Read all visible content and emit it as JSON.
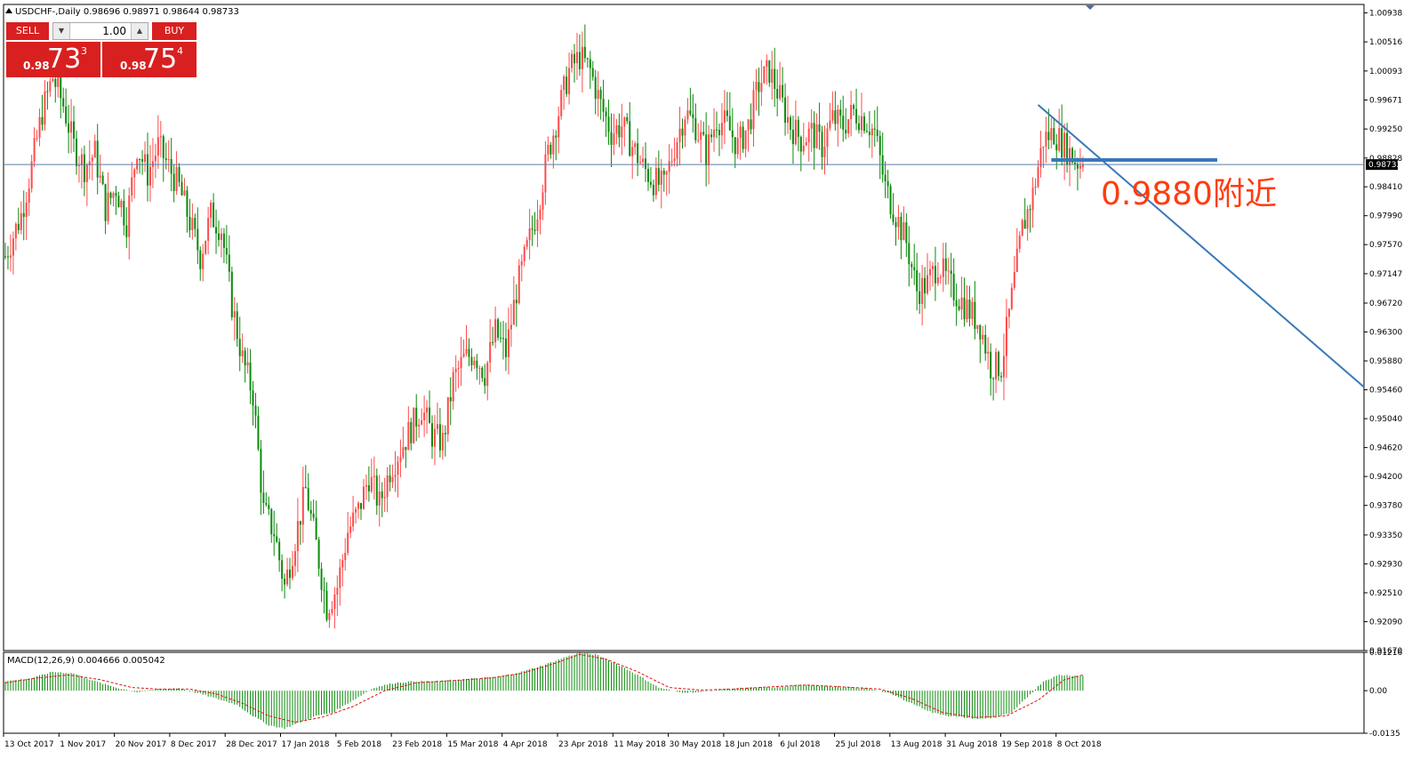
{
  "window": {
    "header": "USDCHF-,Daily  0.98696 0.98971 0.98644 0.98733"
  },
  "trade_panel": {
    "sell_label": "SELL",
    "buy_label": "BUY",
    "lot": "1.00",
    "lot_down_icon": "triangle-down-icon",
    "lot_up_icon": "triangle-up-icon",
    "sell_small": "0.98",
    "sell_big": "73",
    "sell_sup": "3",
    "buy_small": "0.98",
    "buy_big": "75",
    "buy_sup": "4",
    "color": "#d82020"
  },
  "annotation": {
    "text": "0.9880附近",
    "color": "#ff3c10",
    "trendline_color": "#3a78b8"
  },
  "colors": {
    "bull": "#ff4a4a",
    "bear": "#0b8a0b",
    "grid_line": "#5b7fa6",
    "macd_hist": "#0b8a0b",
    "macd_signal": "#e01010"
  },
  "chart_data": [
    {
      "type": "candlestick",
      "symbol": "USDCHF-",
      "timeframe": "Daily",
      "ohlc_header": {
        "open": 0.98696,
        "high": 0.98971,
        "low": 0.98644,
        "close": 0.98733
      },
      "current_price": "0.98733",
      "y_ticks": [
        "1.00938",
        "1.00516",
        "1.00093",
        "0.99671",
        "0.99250",
        "0.98828",
        "0.98410",
        "0.97990",
        "0.97570",
        "0.97147",
        "0.96720",
        "0.96300",
        "0.95880",
        "0.95460",
        "0.95040",
        "0.94620",
        "0.94200",
        "0.93780",
        "0.93350",
        "0.92930",
        "0.92510",
        "0.92090",
        "0.91670"
      ],
      "ylim": [
        0.9167,
        1.0106
      ],
      "x_labels": [
        "13 Oct 2017",
        "1 Nov 2017",
        "20 Nov 2017",
        "8 Dec 2017",
        "28 Dec 2017",
        "17 Jan 2018",
        "5 Feb 2018",
        "23 Feb 2018",
        "15 Mar 2018",
        "4 Apr 2018",
        "23 Apr 2018",
        "11 May 2018",
        "30 May 2018",
        "18 Jun 2018",
        "6 Jul 2018",
        "25 Jul 2018",
        "13 Aug 2018",
        "31 Aug 2018",
        "19 Sep 2018",
        "8 Oct 2018"
      ],
      "close_path": [
        [
          0,
          0.974
        ],
        [
          6,
          0.98
        ],
        [
          10,
          0.987
        ],
        [
          14,
          0.995
        ],
        [
          18,
          1.0
        ],
        [
          22,
          0.996
        ],
        [
          26,
          0.99
        ],
        [
          30,
          0.987
        ],
        [
          34,
          0.989
        ],
        [
          38,
          0.981
        ],
        [
          42,
          0.984
        ],
        [
          46,
          0.979
        ],
        [
          50,
          0.99
        ],
        [
          54,
          0.986
        ],
        [
          58,
          0.99
        ],
        [
          62,
          0.987
        ],
        [
          66,
          0.984
        ],
        [
          70,
          0.979
        ],
        [
          74,
          0.974
        ],
        [
          78,
          0.98
        ],
        [
          82,
          0.978
        ],
        [
          86,
          0.967
        ],
        [
          90,
          0.959
        ],
        [
          94,
          0.954
        ],
        [
          98,
          0.937
        ],
        [
          102,
          0.934
        ],
        [
          106,
          0.926
        ],
        [
          110,
          0.933
        ],
        [
          114,
          0.94
        ],
        [
          118,
          0.932
        ],
        [
          122,
          0.923
        ],
        [
          126,
          0.926
        ],
        [
          130,
          0.934
        ],
        [
          134,
          0.937
        ],
        [
          138,
          0.942
        ],
        [
          142,
          0.938
        ],
        [
          146,
          0.943
        ],
        [
          150,
          0.946
        ],
        [
          154,
          0.949
        ],
        [
          158,
          0.952
        ],
        [
          162,
          0.948
        ],
        [
          166,
          0.947
        ],
        [
          170,
          0.956
        ],
        [
          174,
          0.959
        ],
        [
          178,
          0.96
        ],
        [
          182,
          0.957
        ],
        [
          186,
          0.963
        ],
        [
          190,
          0.96
        ],
        [
          194,
          0.969
        ],
        [
          198,
          0.975
        ],
        [
          202,
          0.981
        ],
        [
          206,
          0.989
        ],
        [
          210,
          0.995
        ],
        [
          214,
          1.001
        ],
        [
          218,
          1.003
        ],
        [
          222,
          1.001
        ],
        [
          226,
          0.996
        ],
        [
          230,
          0.992
        ],
        [
          234,
          0.993
        ],
        [
          238,
          0.99
        ],
        [
          242,
          0.987
        ],
        [
          246,
          0.985
        ],
        [
          250,
          0.984
        ],
        [
          254,
          0.99
        ],
        [
          258,
          0.995
        ],
        [
          262,
          0.993
        ],
        [
          266,
          0.989
        ],
        [
          270,
          0.994
        ],
        [
          274,
          0.993
        ],
        [
          278,
          0.99
        ],
        [
          282,
          0.993
        ],
        [
          286,
          0.999
        ],
        [
          290,
          1.001
        ],
        [
          294,
          0.997
        ],
        [
          298,
          0.993
        ],
        [
          302,
          0.991
        ],
        [
          306,
          0.992
        ],
        [
          310,
          0.99
        ],
        [
          314,
          0.994
        ],
        [
          318,
          0.993
        ],
        [
          322,
          0.995
        ],
        [
          326,
          0.994
        ],
        [
          330,
          0.992
        ],
        [
          334,
          0.984
        ],
        [
          338,
          0.98
        ],
        [
          342,
          0.976
        ],
        [
          346,
          0.969
        ],
        [
          350,
          0.97
        ],
        [
          354,
          0.973
        ],
        [
          358,
          0.97
        ],
        [
          362,
          0.968
        ],
        [
          366,
          0.966
        ],
        [
          370,
          0.964
        ],
        [
          374,
          0.958
        ],
        [
          378,
          0.958
        ],
        [
          382,
          0.968
        ],
        [
          386,
          0.978
        ],
        [
          390,
          0.983
        ],
        [
          394,
          0.991
        ],
        [
          398,
          0.992
        ],
        [
          402,
          0.99
        ],
        [
          406,
          0.988
        ],
        [
          409,
          0.9873
        ]
      ],
      "trendline_desc": [
        [
          392,
          0.996
        ],
        [
          470,
          0.955
        ]
      ],
      "horizontal_level": 0.988
    },
    {
      "type": "bar",
      "indicator": "MACD(12,26,9)",
      "header": "MACD(12,26,9) 0.004666 0.005042",
      "main": 0.004666,
      "signal_value": 0.005042,
      "y_ticks": [
        "0.01216",
        "0.00",
        "-0.0135"
      ],
      "ylim": [
        -0.0135,
        0.01216
      ],
      "histogram_knots": [
        [
          0,
          0.003
        ],
        [
          10,
          0.004
        ],
        [
          18,
          0.006
        ],
        [
          26,
          0.0055
        ],
        [
          34,
          0.003
        ],
        [
          42,
          0.001
        ],
        [
          50,
          -0.0005
        ],
        [
          58,
          0.0005
        ],
        [
          66,
          0.0008
        ],
        [
          74,
          -0.001
        ],
        [
          82,
          -0.003
        ],
        [
          88,
          -0.0045
        ],
        [
          94,
          -0.008
        ],
        [
          100,
          -0.011
        ],
        [
          106,
          -0.012
        ],
        [
          112,
          -0.01
        ],
        [
          118,
          -0.008
        ],
        [
          124,
          -0.007
        ],
        [
          132,
          -0.003
        ],
        [
          140,
          0.001
        ],
        [
          148,
          0.0025
        ],
        [
          156,
          0.003
        ],
        [
          164,
          0.003
        ],
        [
          172,
          0.0035
        ],
        [
          180,
          0.004
        ],
        [
          188,
          0.0045
        ],
        [
          196,
          0.006
        ],
        [
          204,
          0.008
        ],
        [
          212,
          0.0105
        ],
        [
          218,
          0.012
        ],
        [
          224,
          0.0115
        ],
        [
          232,
          0.0085
        ],
        [
          240,
          0.005
        ],
        [
          248,
          0.001
        ],
        [
          256,
          -0.0005
        ],
        [
          264,
          -0.0005
        ],
        [
          272,
          0.0005
        ],
        [
          280,
          0.0008
        ],
        [
          288,
          0.001
        ],
        [
          296,
          0.0012
        ],
        [
          304,
          0.002
        ],
        [
          312,
          0.0015
        ],
        [
          320,
          0.001
        ],
        [
          328,
          0.0008
        ],
        [
          336,
          -0.001
        ],
        [
          344,
          -0.004
        ],
        [
          352,
          -0.007
        ],
        [
          358,
          -0.008
        ],
        [
          364,
          -0.0085
        ],
        [
          370,
          -0.009
        ],
        [
          376,
          -0.0085
        ],
        [
          382,
          -0.007
        ],
        [
          388,
          -0.002
        ],
        [
          394,
          0.003
        ],
        [
          400,
          0.005
        ],
        [
          409,
          0.0047
        ]
      ],
      "signal_knots": [
        [
          0,
          0.0025
        ],
        [
          12,
          0.004
        ],
        [
          24,
          0.005
        ],
        [
          36,
          0.0035
        ],
        [
          48,
          0.001
        ],
        [
          58,
          0.0005
        ],
        [
          70,
          0.0005
        ],
        [
          80,
          -0.001
        ],
        [
          90,
          -0.004
        ],
        [
          100,
          -0.008
        ],
        [
          110,
          -0.01
        ],
        [
          120,
          -0.0085
        ],
        [
          132,
          -0.005
        ],
        [
          144,
          0.0
        ],
        [
          156,
          0.0025
        ],
        [
          170,
          0.0032
        ],
        [
          184,
          0.004
        ],
        [
          196,
          0.0055
        ],
        [
          208,
          0.0085
        ],
        [
          218,
          0.0115
        ],
        [
          228,
          0.01
        ],
        [
          240,
          0.006
        ],
        [
          252,
          0.001
        ],
        [
          264,
          0.0002
        ],
        [
          276,
          0.0005
        ],
        [
          290,
          0.0012
        ],
        [
          304,
          0.0018
        ],
        [
          318,
          0.0012
        ],
        [
          332,
          0.0005
        ],
        [
          344,
          -0.0025
        ],
        [
          356,
          -0.007
        ],
        [
          368,
          -0.0085
        ],
        [
          380,
          -0.008
        ],
        [
          392,
          -0.003
        ],
        [
          402,
          0.0035
        ],
        [
          409,
          0.005
        ]
      ]
    }
  ]
}
